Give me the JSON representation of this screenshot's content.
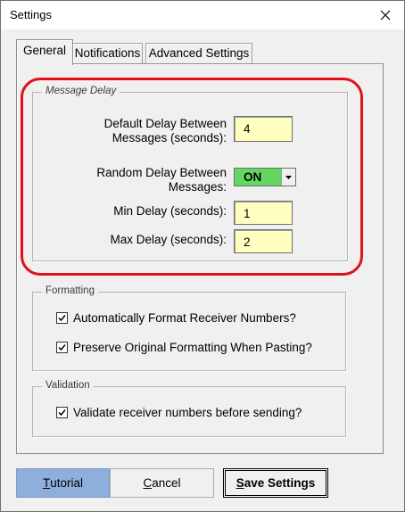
{
  "window": {
    "title": "Settings"
  },
  "tabs": [
    {
      "label": "General",
      "active": true
    },
    {
      "label": "Notifications",
      "active": false
    },
    {
      "label": "Advanced Settings",
      "active": false
    }
  ],
  "message_delay": {
    "legend": "Message Delay",
    "default_delay_label_1": "Default Delay Between",
    "default_delay_label_2": "Messages (seconds):",
    "default_delay_value": "4",
    "random_delay_label_1": "Random Delay Between",
    "random_delay_label_2": "Messages:",
    "random_delay_value": "ON",
    "random_delay_color": "#62d862",
    "min_delay_label": "Min Delay (seconds):",
    "min_delay_value": "1",
    "max_delay_label": "Max Delay (seconds):",
    "max_delay_value": "2"
  },
  "formatting": {
    "legend": "Formatting",
    "auto_format_label": "Automatically Format Receiver Numbers?",
    "auto_format_checked": true,
    "preserve_label": "Preserve Original Formatting When Pasting?",
    "preserve_checked": true
  },
  "validation": {
    "legend": "Validation",
    "validate_label": "Validate receiver numbers before sending?",
    "validate_checked": true
  },
  "buttons": {
    "tutorial_first": "T",
    "tutorial_rest": "utorial",
    "cancel_first": "C",
    "cancel_rest": "ancel",
    "save_first": "S",
    "save_rest": "ave Settings"
  },
  "colors": {
    "highlight": "#e0101a",
    "field_bg": "#ffffc0",
    "tutorial_bg": "#8eaedb"
  },
  "icons": {
    "close": "close-icon",
    "dropdown": "chevron-down-icon",
    "check": "checkmark-icon"
  }
}
